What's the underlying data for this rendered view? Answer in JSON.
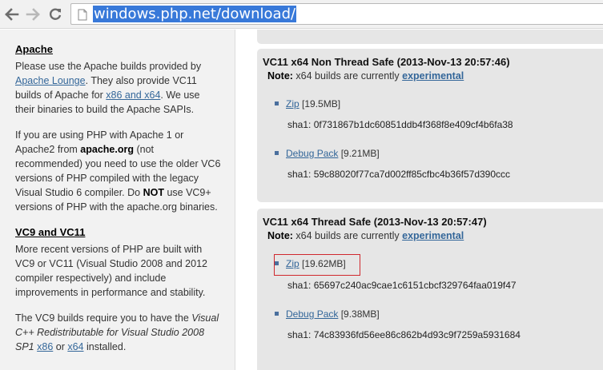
{
  "browser": {
    "url": "windows.php.net/download/"
  },
  "left": {
    "apache": {
      "title": "Apache",
      "p1_a": "Please use the Apache builds provided by ",
      "p1_link1": "Apache Lounge",
      "p1_b": ". They also provide VC11 builds of Apache for ",
      "p1_link2": "x86 and x64",
      "p1_c": ". We use their binaries to build the Apache SAPIs.",
      "p2_a": "If you are using PHP with Apache 1 or Apache2 from ",
      "p2_bold1": "apache.org",
      "p2_b": " (not recommended) you need to use the older VC6 versions of PHP compiled with the legacy Visual Studio 6 compiler. Do ",
      "p2_bold2": "NOT",
      "p2_c": " use VC9+ versions of PHP with the apache.org binaries."
    },
    "vc": {
      "title": "VC9 and VC11",
      "p1": "More recent versions of PHP are built with VC9 or VC11 (Visual Studio 2008 and 2012 compiler respectively) and include improvements in performance and stability.",
      "p2_a": "The VC9 builds require you to have the ",
      "p2_em": "Visual C++ Redistributable for Visual Studio 2008 SP1",
      "p2_link1": "x86",
      "p2_or": " or ",
      "p2_link2": "x64",
      "p2_end": " installed."
    }
  },
  "builds": [
    {
      "title": "VC11 x64 Non Thread Safe (2013-Nov-13 20:57:46)",
      "note_label": "Note:",
      "note_text": " x64 builds are currently ",
      "note_link": "experimental",
      "zip_label": "Zip",
      "zip_size": "[19.5MB]",
      "zip_sha": "sha1: 0f731867b1dc60851ddb4f368f8e409cf4b6fa38",
      "debug_label": "Debug Pack",
      "debug_size": "[9.21MB]",
      "debug_sha": "sha1: 59c88020f77ca7d002ff85cfbc4b36f57d390ccc"
    },
    {
      "title": "VC11 x64 Thread Safe (2013-Nov-13 20:57:47)",
      "note_label": "Note:",
      "note_text": " x64 builds are currently ",
      "note_link": "experimental",
      "zip_label": "Zip",
      "zip_size": "[19.62MB]",
      "zip_sha": "sha1: 65697c240ac9cae1c6151cbcf329764faa019f47",
      "debug_label": "Debug Pack",
      "debug_size": "[9.38MB]",
      "debug_sha": "sha1: 74c83936fd56ee86c862b4d93c9f7259a5931684"
    }
  ],
  "colors": {
    "link": "#336699",
    "highlight_box": "#d0282e",
    "panel_bg": "#e6e6e6",
    "sidebar_bg": "#f2f2f2",
    "selection": "#3879d9"
  }
}
